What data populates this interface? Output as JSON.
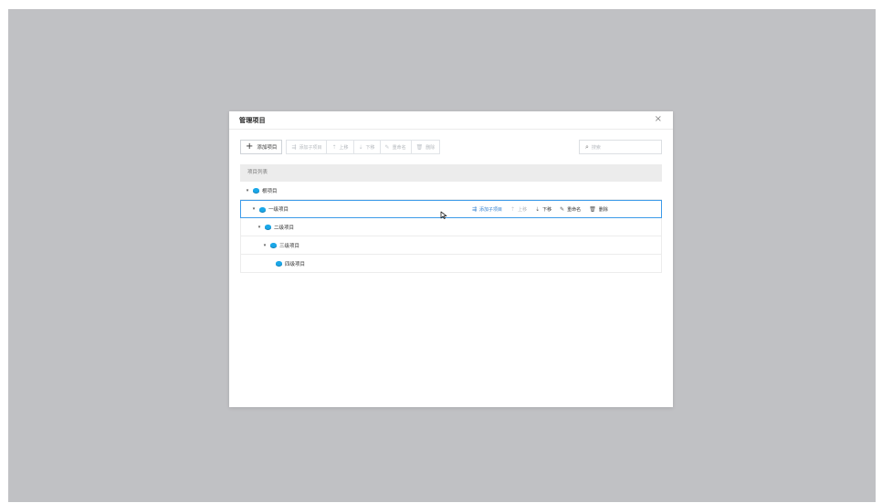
{
  "dialog": {
    "title": "管理项目",
    "close_glyph": "×"
  },
  "toolbar": {
    "add_label": "添加项目",
    "add_glyph": "+",
    "buttons": [
      {
        "label": "添加子项目",
        "icon": "add-child-icon",
        "glyph": "⇶"
      },
      {
        "label": "上移",
        "icon": "move-up-icon",
        "glyph": "⇡"
      },
      {
        "label": "下移",
        "icon": "move-down-icon",
        "glyph": "⇣"
      },
      {
        "label": "重命名",
        "icon": "rename-icon",
        "glyph": "✎"
      },
      {
        "label": "删除",
        "icon": "delete-icon",
        "glyph": "🗑"
      }
    ]
  },
  "search": {
    "placeholder": "搜索",
    "icon_glyph": "⌕"
  },
  "list": {
    "header": "项目列表",
    "nodes": [
      {
        "label": "根项目",
        "level": 0,
        "expanded": true
      },
      {
        "label": "一级项目",
        "level": 1,
        "expanded": true,
        "selected": true
      },
      {
        "label": "二级项目",
        "level": 2,
        "expanded": true
      },
      {
        "label": "三级项目",
        "level": 3,
        "expanded": true
      },
      {
        "label": "四级项目",
        "level": 4,
        "expanded": false
      }
    ],
    "caret_glyph": "▾"
  },
  "row_actions": [
    {
      "label": "添加子项目",
      "icon": "add-child-icon",
      "glyph": "⇶",
      "state": "accent"
    },
    {
      "label": "上移",
      "icon": "move-up-icon",
      "glyph": "⇡",
      "state": "disabled"
    },
    {
      "label": "下移",
      "icon": "move-down-icon",
      "glyph": "⇣",
      "state": "enabled"
    },
    {
      "label": "重命名",
      "icon": "rename-icon",
      "glyph": "✎",
      "state": "enabled"
    },
    {
      "label": "删除",
      "icon": "delete-icon",
      "glyph": "🗑",
      "state": "enabled"
    }
  ],
  "colors": {
    "backdrop": "#c0c1c4",
    "accent": "#2f7fd0",
    "selected_border": "#3d9be9",
    "node_icon": "#1aa7e8"
  }
}
